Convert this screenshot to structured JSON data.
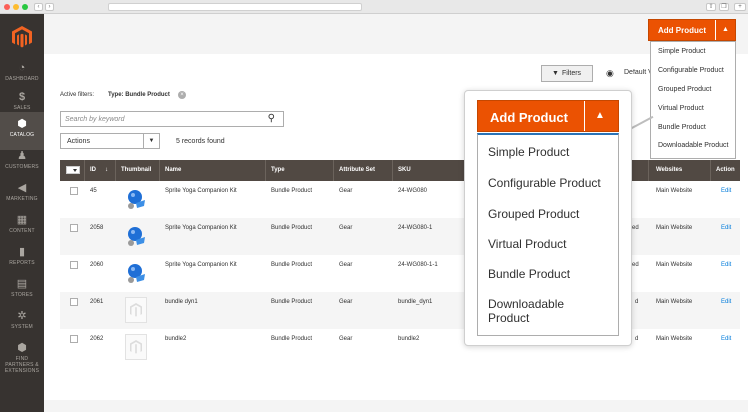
{
  "sidebar": {
    "items": [
      {
        "label": "DASHBOARD",
        "icon": "dashboard-icon"
      },
      {
        "label": "SALES",
        "icon": "dollar-icon"
      },
      {
        "label": "CATALOG",
        "icon": "cube-icon"
      },
      {
        "label": "CUSTOMERS",
        "icon": "person-icon"
      },
      {
        "label": "MARKETING",
        "icon": "megaphone-icon"
      },
      {
        "label": "CONTENT",
        "icon": "layout-icon"
      },
      {
        "label": "REPORTS",
        "icon": "bar-chart-icon"
      },
      {
        "label": "STORES",
        "icon": "store-icon"
      },
      {
        "label": "SYSTEM",
        "icon": "gear-icon"
      },
      {
        "label": "FIND PARTNERS & EXTENSIONS",
        "icon": "extensions-icon"
      }
    ]
  },
  "header": {
    "add_product_label": "Add Product",
    "add_product_menu": [
      "Simple Product",
      "Configurable Product",
      "Grouped Product",
      "Virtual Product",
      "Bundle Product",
      "Downloadable Product"
    ]
  },
  "toolbar": {
    "filters_label": "Filters",
    "view_label": "Default View",
    "active_filters_label": "Active filters:",
    "active_filter_chip": "Type: Bundle Product",
    "search_placeholder": "Search by keyword",
    "actions_label": "Actions",
    "records_found": "5 records found"
  },
  "table": {
    "columns": [
      "ID",
      "Thumbnail",
      "Name",
      "Type",
      "Attribute Set",
      "SKU",
      "Websites",
      "Action"
    ],
    "rows": [
      {
        "id": "45",
        "thumb": "ball",
        "name": "Sprite Yoga Companion Kit",
        "type": "Bundle Product",
        "attribute_set": "Gear",
        "sku": "24-WG080",
        "status_suffix": "",
        "websites": "Main Website",
        "action": "Edit"
      },
      {
        "id": "2058",
        "thumb": "ball",
        "name": "Sprite Yoga Companion Kit",
        "type": "Bundle Product",
        "attribute_set": "Gear",
        "sku": "24-WG080-1",
        "status_suffix": "ed",
        "websites": "Main Website",
        "action": "Edit"
      },
      {
        "id": "2060",
        "thumb": "ball",
        "name": "Sprite Yoga Companion Kit",
        "type": "Bundle Product",
        "attribute_set": "Gear",
        "sku": "24-WG080-1-1",
        "status_suffix": "ed",
        "websites": "Main Website",
        "action": "Edit"
      },
      {
        "id": "2061",
        "thumb": "placeholder",
        "name": "bundle dyn1",
        "type": "Bundle Product",
        "attribute_set": "Gear",
        "sku": "bundle_dyn1",
        "status_suffix": "d",
        "websites": "Main Website",
        "action": "Edit"
      },
      {
        "id": "2062",
        "thumb": "placeholder",
        "name": "bundle2",
        "type": "Bundle Product",
        "attribute_set": "Gear",
        "sku": "bundle2",
        "status_suffix": "d",
        "websites": "Main Website",
        "action": "Edit"
      }
    ]
  },
  "zoom_panel": {
    "button_label": "Add Product",
    "items": [
      "Simple Product",
      "Configurable Product",
      "Grouped Product",
      "Virtual Product",
      "Bundle Product",
      "Downloadable Product"
    ]
  },
  "colors": {
    "accent": "#eb5202",
    "sidebar": "#373330",
    "table_header": "#514943",
    "link": "#007bdb"
  }
}
